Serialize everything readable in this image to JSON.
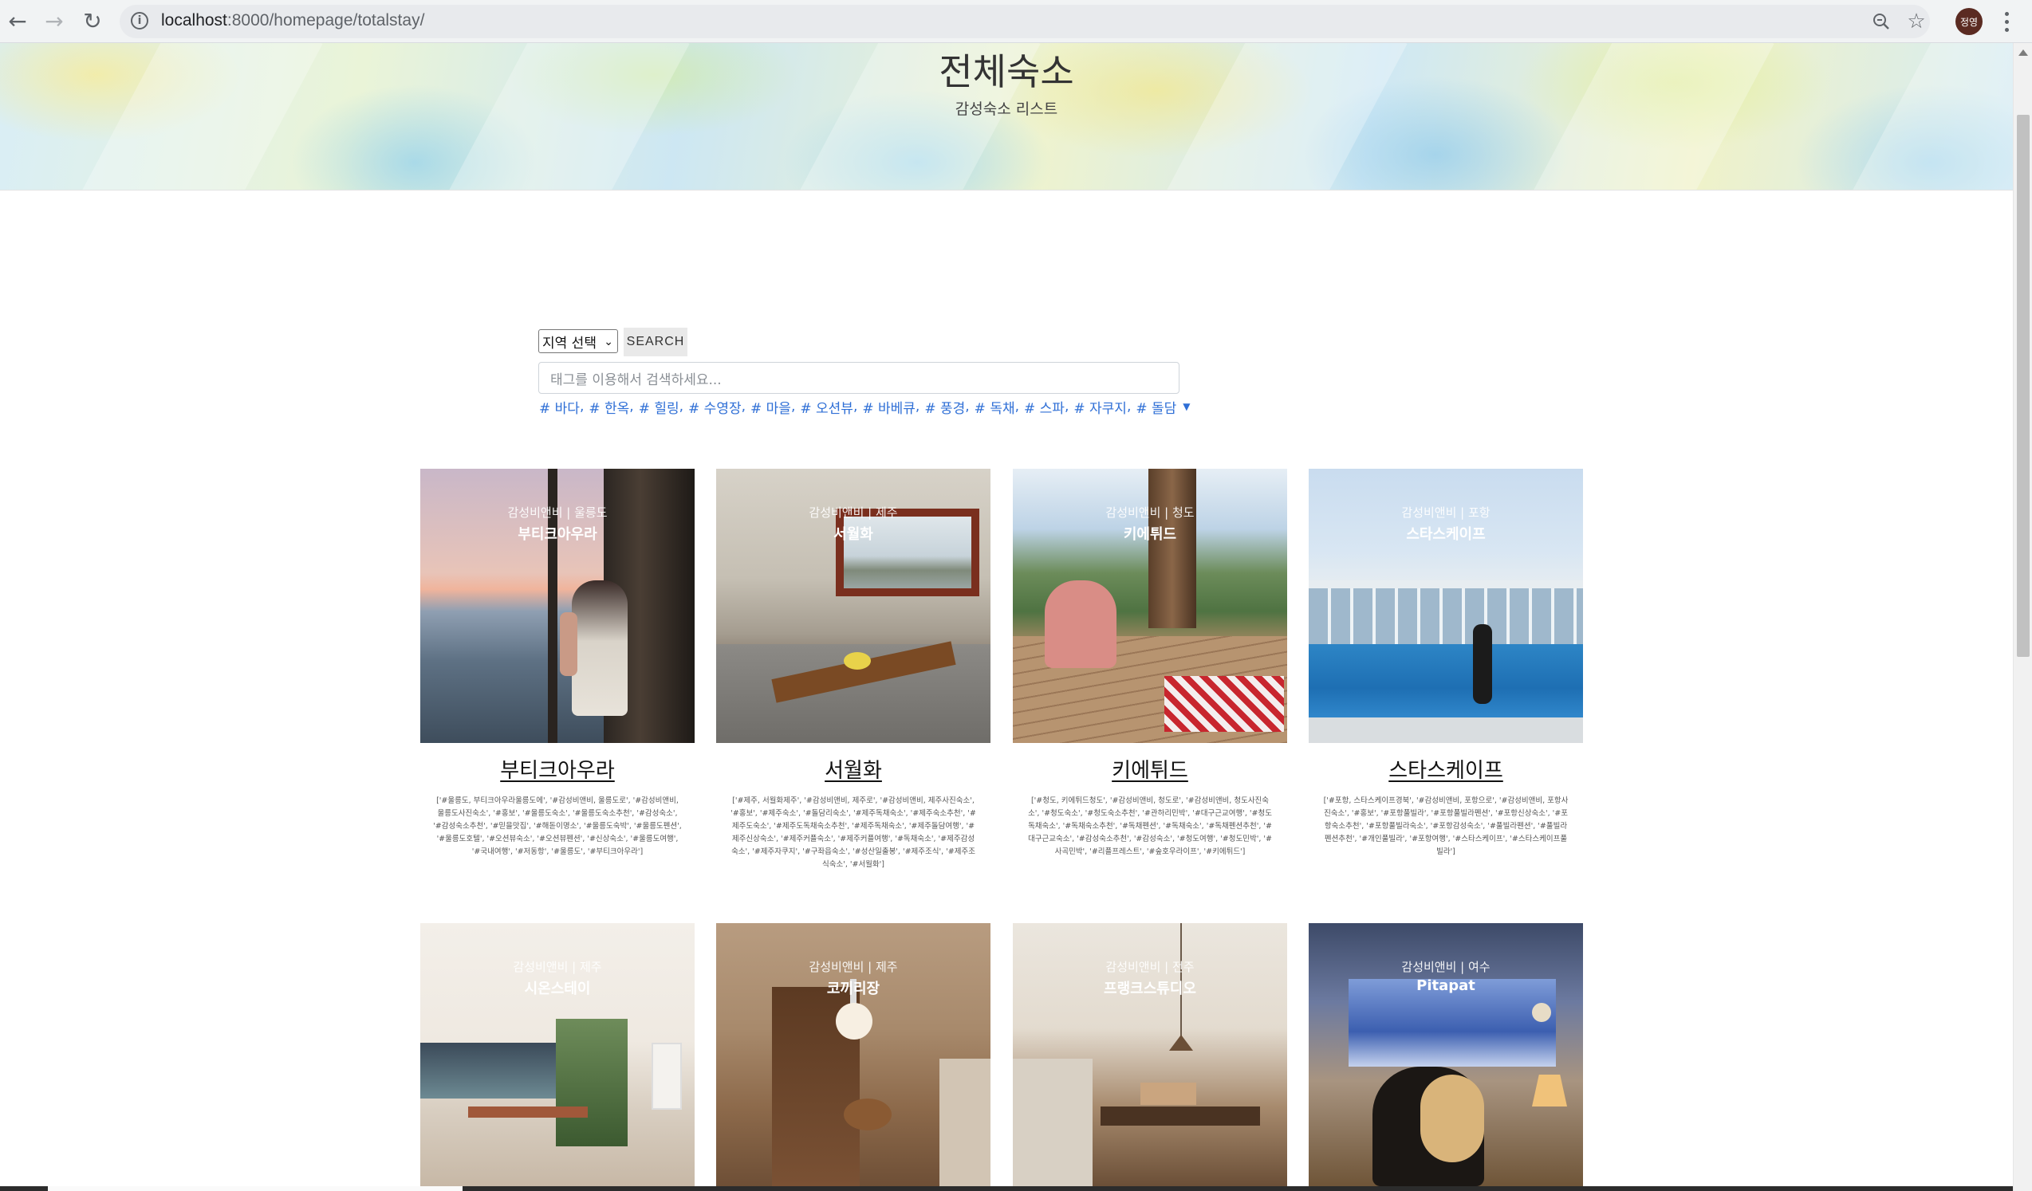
{
  "browser": {
    "url_host": "localhost",
    "url_path": ":8000/homepage/totalstay/",
    "profile_label": "정영"
  },
  "hero": {
    "title": "전체숙소",
    "subtitle": "감성숙소 리스트"
  },
  "search": {
    "region_select_value": "지역 선택",
    "button_label": "SEARCH",
    "tag_placeholder": "태그를 이용해서 검색하세요...",
    "tags": [
      "# 바다",
      "# 한옥",
      "# 힐링",
      "# 수영장",
      "# 마을",
      "# 오션뷰",
      "# 바베큐",
      "# 풍경",
      "# 독채",
      "# 스파",
      "# 자쿠지",
      "# 돌담"
    ]
  },
  "stays": [
    {
      "overlay_top": "감성비앤비 | 울릉도",
      "overlay_name": "부티크아우라",
      "name": "부티크아우라",
      "desc": "['#울릉도, 부티크아우라울릉도에', '#감성비앤비, 울릉도로', '#감성비앤비, 울릉도사진숙소', '#홍보', '#울릉도숙소', '#울릉도숙소추천', '#감성숙소', '#감성숙소추천', '#믿을맛집', '#해돋이명소', '#울릉도숙박', '#울릉도펜션', '#울릉도호텔', '#오션뷰숙소', '#오션뷰펜션', '#신상숙소', '#울릉도여행', '#국내여행', '#저동항', '#울릉도', '#부티크아우라']"
    },
    {
      "overlay_top": "감성비앤비 | 제주",
      "overlay_name": "서월화",
      "name": "서월화",
      "desc": "['#제주, 서월화제주', '#감성비앤비, 제주로', '#감성비앤비, 제주사진숙소', '#홍보', '#제주숙소', '#돌담리숙소', '#제주독채숙소', '#제주숙소추천', '#제주도숙소', '#제주도독채숙소추천', '#제주독채숙소', '#제주돌담여행', '#제주신상숙소', '#제주커플숙소', '#제주커플여행', '#독채숙소', '#제주감성숙소', '#제주자쿠지', '#구좌읍숙소', '#성산일출봉', '#제주조식', '#제주조식숙소', '#서월화']"
    },
    {
      "overlay_top": "감성비앤비 | 청도",
      "overlay_name": "키에튀드",
      "name": "키에튀드",
      "desc": "['#청도, 키에튀드청도', '#감성비앤비, 청도로', '#감성비앤비, 청도사진숙소', '#청도숙소', '#청도숙소추천', '#관하리민박', '#대구근교여행', '#청도독채숙소', '#독채숙소추천', '#독채펜션', '#독채숙소', '#독채펜션추천', '#대구근교숙소', '#감성숙소추천', '#감성숙소', '#청도여행', '#청도민박', '#사곡민박', '#리플프레스트', '#숲호우라이프', '#키에튀드']"
    },
    {
      "overlay_top": "감성비앤비 | 포항",
      "overlay_name": "스타스케이프",
      "name": "스타스케이프",
      "desc": "['#포항, 스타스케이프경북', '#감성비앤비, 포항으로', '#감성비앤비, 포항사진숙소', '#홍보', '#포항풀빌라', '#포항풀빌라펜션', '#포항신상숙소', '#포항숙소추천', '#포항풀빌라숙소', '#포항감성숙소', '#풀빌라펜션', '#풀빌라펜션추천', '#개인풀빌라', '#포항여행', '#스타스케이프', '#스타스케이프풀빌라']"
    },
    {
      "overlay_top": "감성비앤비 | 제주",
      "overlay_name": "시온스테이"
    },
    {
      "overlay_top": "감성비앤비 | 제주",
      "overlay_name": "코끼리장"
    },
    {
      "overlay_top": "감성비앤비 | 전주",
      "overlay_name": "프랭크스튜디오"
    },
    {
      "overlay_top": "감성비앤비 | 여수",
      "overlay_name": "Pitapat"
    }
  ]
}
